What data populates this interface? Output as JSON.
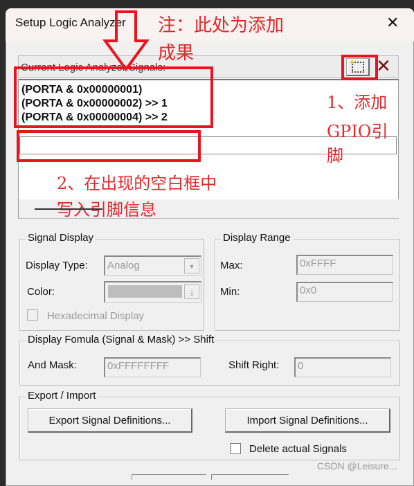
{
  "window": {
    "title": "Setup Logic Analyzer",
    "close": "✕"
  },
  "signals": {
    "header": "Current Logic Analyzer Signals:",
    "new_icon": "new-signal-icon",
    "delete_icon": "delete-signal-icon",
    "delete_glyph": "✕",
    "items": [
      "(PORTA & 0x00000001)",
      "(PORTA & 0x00000002) >> 1",
      "(PORTA & 0x00000004) >> 2"
    ],
    "edit_value": ""
  },
  "annotations": {
    "note1": "注：此处为添加",
    "note2": "成果",
    "step1a": "1、添加",
    "step1b": "GPIO引",
    "step1c": "脚",
    "step2a": "2、在出现的空白框中",
    "step2b": "写入引脚信息",
    "color": "#e8262a"
  },
  "signal_display": {
    "title": "Signal Display",
    "display_type_label": "Display Type:",
    "display_type_value": "Analog",
    "color_label": "Color:",
    "hex_label": "Hexadecimal Display",
    "hex_checked": false
  },
  "display_range": {
    "title": "Display Range",
    "max_label": "Max:",
    "max_value": "0xFFFF",
    "min_label": "Min:",
    "min_value": "0x0"
  },
  "formula": {
    "title": "Display Fomula (Signal & Mask) >> Shift",
    "mask_label": "And Mask:",
    "mask_value": "0xFFFFFFFF",
    "shift_label": "Shift Right:",
    "shift_value": "0"
  },
  "export_import": {
    "title": "Export / Import",
    "export_button": "Export Signal Definitions...",
    "import_button": "Import Signal Definitions...",
    "delete_label": "Delete actual Signals",
    "delete_checked": false
  },
  "watermark": "CSDN @Leisure..."
}
